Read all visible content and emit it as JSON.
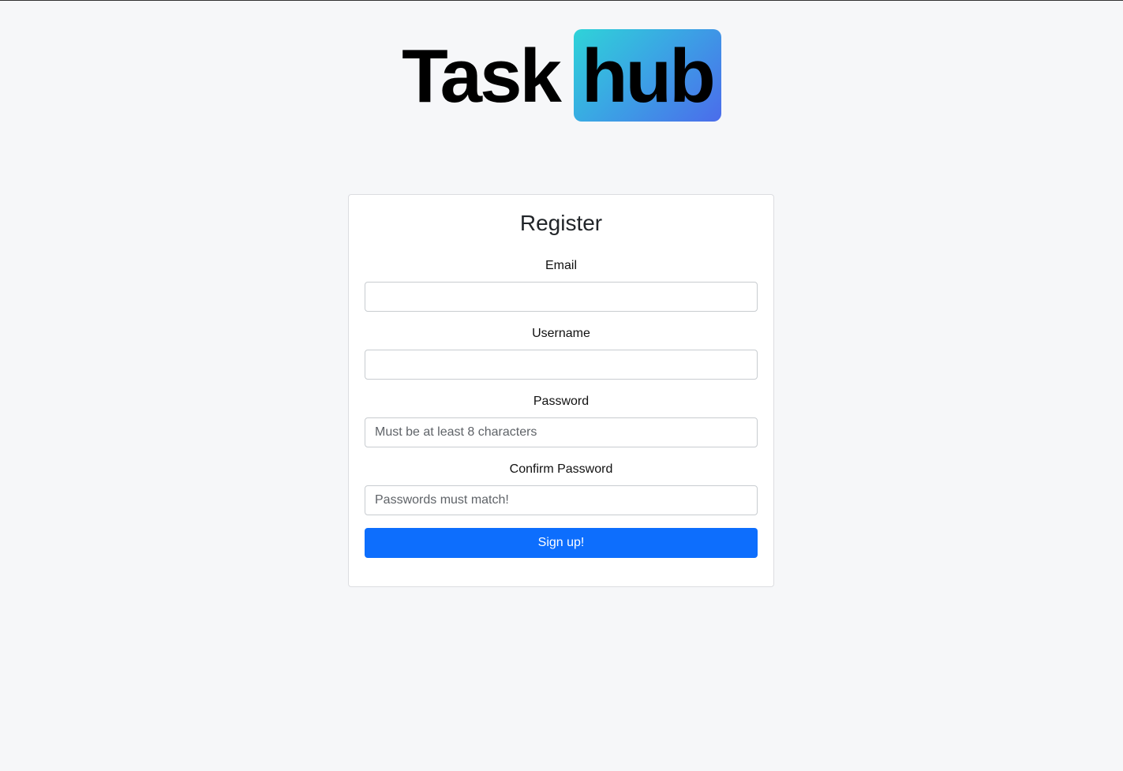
{
  "logo": {
    "word_task": "Task",
    "word_hub": "hub"
  },
  "register": {
    "title": "Register",
    "email": {
      "label": "Email",
      "value": "",
      "placeholder": ""
    },
    "username": {
      "label": "Username",
      "value": "",
      "placeholder": ""
    },
    "password": {
      "label": "Password",
      "value": "",
      "placeholder": "Must be at least 8 characters"
    },
    "confirm_password": {
      "label": "Confirm Password",
      "value": "",
      "placeholder": "Passwords must match!"
    },
    "submit_label": "Sign up!"
  },
  "colors": {
    "page_background": "#f6f7f9",
    "logo_gradient_start": "#2fd3d8",
    "logo_gradient_end": "#4b6ceb",
    "button_primary": "#0d6efd"
  }
}
